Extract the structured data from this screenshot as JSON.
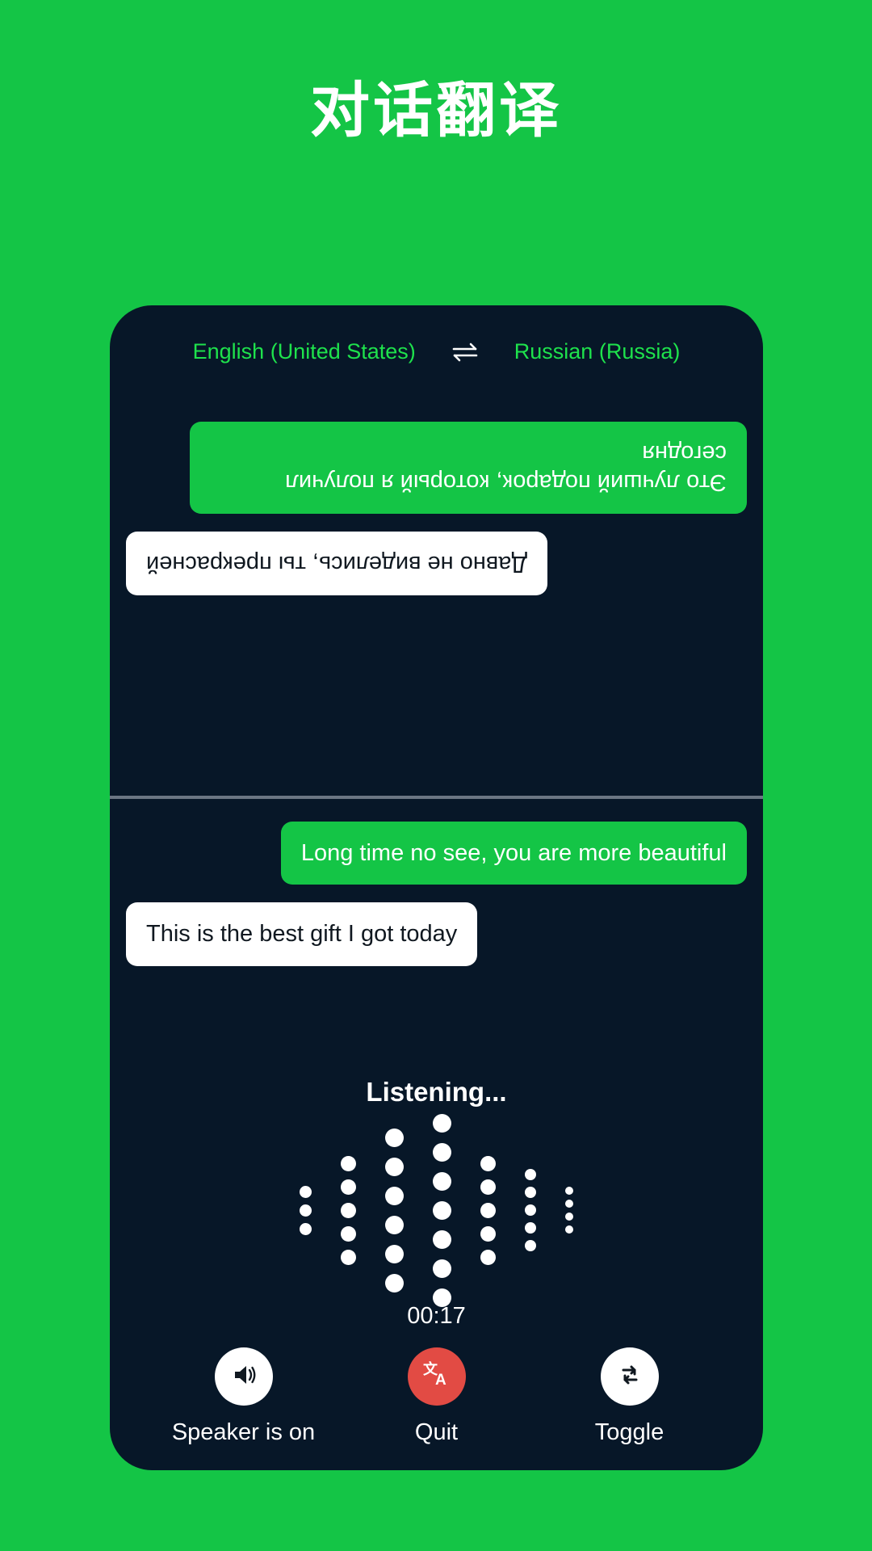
{
  "page": {
    "title": "对话翻译",
    "background_color": "#14c546"
  },
  "card": {
    "background_color": "#071728",
    "language_bar": {
      "source_language": "English (United States)",
      "swap_icon": "swap-horizontal-icon",
      "target_language": "Russian (Russia)",
      "text_color": "#1ee24c"
    },
    "conversation": {
      "top_panel_rotated": true,
      "top_messages": [
        {
          "text": "Это лучший подарок, который я получил сегодня",
          "style": "green",
          "align": "left"
        },
        {
          "text": "Давно не виделись, ты прекрасней",
          "style": "white",
          "align": "right"
        }
      ],
      "bottom_messages": [
        {
          "text": "Long time no see, you are more beautiful",
          "style": "green",
          "align": "right"
        },
        {
          "text": "This is the best gift I got today",
          "style": "white",
          "align": "left"
        }
      ],
      "bubble_green_color": "#14c546",
      "bubble_white_color": "#ffffff"
    },
    "status": {
      "listening_label": "Listening...",
      "timer": "00:17"
    },
    "waveform": {
      "columns": [
        {
          "dots": 3,
          "size": 15
        },
        {
          "dots": 5,
          "size": 19
        },
        {
          "dots": 6,
          "size": 23
        },
        {
          "dots": 7,
          "size": 23
        },
        {
          "dots": 5,
          "size": 19
        },
        {
          "dots": 5,
          "size": 14
        },
        {
          "dots": 4,
          "size": 10
        }
      ],
      "dot_color": "#ffffff"
    },
    "controls": [
      {
        "label": "Speaker is on",
        "icon": "speaker-on-icon",
        "circle_color": "#ffffff",
        "icon_color": "#101820"
      },
      {
        "label": "Quit",
        "icon": "translate-icon",
        "circle_color": "#e24b44",
        "icon_color": "#ffffff"
      },
      {
        "label": "Toggle",
        "icon": "swap-repeat-icon",
        "circle_color": "#ffffff",
        "icon_color": "#101820"
      }
    ]
  }
}
